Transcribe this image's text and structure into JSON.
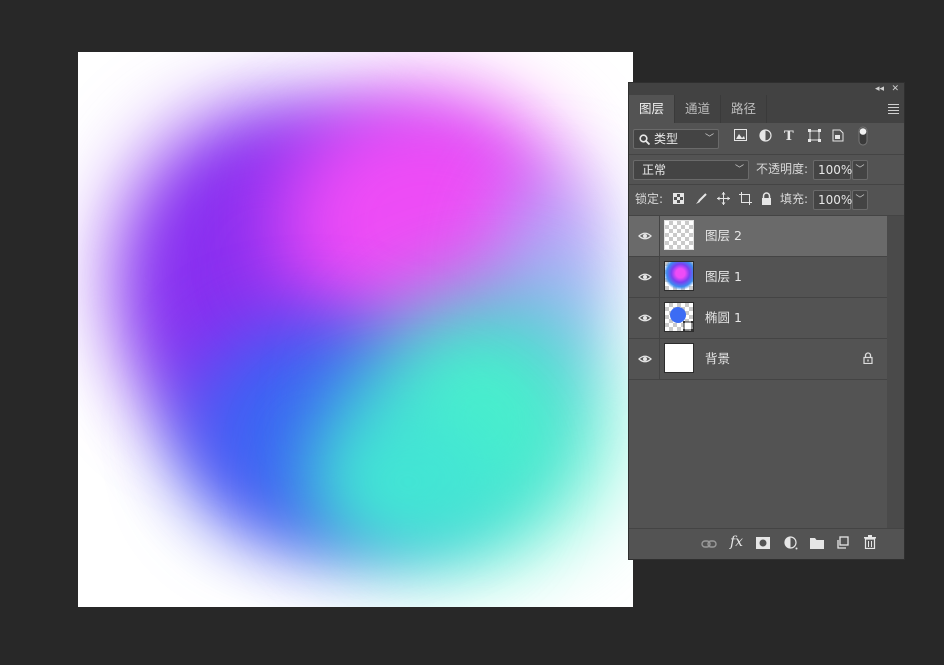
{
  "panel": {
    "tabs": [
      {
        "label": "图层",
        "active": true
      },
      {
        "label": "通道",
        "active": false
      },
      {
        "label": "路径",
        "active": false
      }
    ],
    "filter_kind": "类型",
    "filter_icons": [
      "image-filter-icon",
      "adjustment-filter-icon",
      "type-filter-icon",
      "shape-filter-icon",
      "smart-object-filter-icon",
      "filter-toggle-icon"
    ],
    "blend_mode": "正常",
    "opacity_label": "不透明度:",
    "opacity_value": "100%",
    "lock_label": "锁定:",
    "lock_icons": [
      "lock-transparent-pixels-icon",
      "lock-image-pixels-icon",
      "lock-position-icon",
      "lock-artboard-icon",
      "lock-all-icon"
    ],
    "fill_label": "填充:",
    "fill_value": "100%",
    "layers": [
      {
        "name": "图层 2",
        "selected": true,
        "thumbnail": "transparent"
      },
      {
        "name": "图层 1",
        "selected": false,
        "thumbnail": "gradient-blob"
      },
      {
        "name": "椭圆 1",
        "selected": false,
        "thumbnail": "ellipse-shape"
      },
      {
        "name": "背景",
        "selected": false,
        "thumbnail": "white",
        "locked": true
      }
    ],
    "footer_icons": [
      "link-layers-icon",
      "fx-icon",
      "layer-mask-icon",
      "adjustment-layer-icon",
      "group-folder-icon",
      "new-layer-icon",
      "trash-icon"
    ],
    "footer_fx_text": "fx"
  },
  "colors": {
    "workspace_bg": "#282828",
    "panel_bg": "#535353",
    "selected_layer_bg": "#6a6a6a",
    "canvas_magenta": "#ee4cf6",
    "canvas_purple": "#8a2ff0",
    "canvas_blue": "#3c64f4",
    "canvas_teal": "#4af0cc"
  }
}
